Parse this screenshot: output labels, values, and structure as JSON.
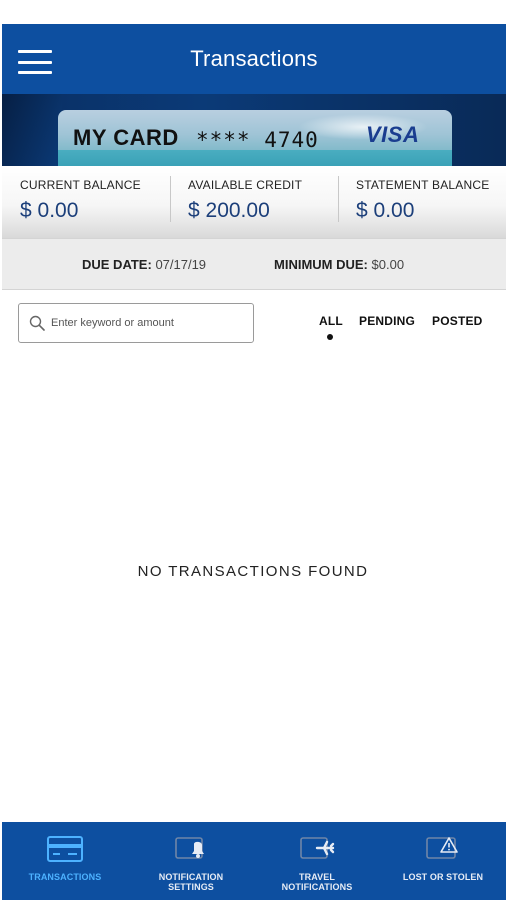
{
  "header": {
    "title": "Transactions",
    "menu_icon": "hamburger-menu-icon"
  },
  "card": {
    "name": "MY CARD",
    "number_masked": "**** 4740",
    "network": "VISA"
  },
  "balances": [
    {
      "label": "CURRENT BALANCE",
      "value": "$ 0.00"
    },
    {
      "label": "AVAILABLE CREDIT",
      "value": "$ 200.00"
    },
    {
      "label": "STATEMENT BALANCE",
      "value": "$ 0.00"
    }
  ],
  "due": {
    "due_date_label": "DUE DATE:",
    "due_date_value": "07/17/19",
    "minimum_due_label": "MINIMUM DUE:",
    "minimum_due_value": "$0.00"
  },
  "search": {
    "placeholder": "Enter keyword or amount",
    "icon": "search-icon"
  },
  "filters": {
    "all": "ALL",
    "pending": "PENDING",
    "posted": "POSTED",
    "selected": "ALL"
  },
  "empty_message": "NO TRANSACTIONS FOUND",
  "bottom_nav": [
    {
      "label": "TRANSACTIONS",
      "icon": "credit-card-icon",
      "active": true
    },
    {
      "label": "NOTIFICATION SETTINGS",
      "icon": "notification-bell-icon",
      "active": false
    },
    {
      "label": "TRAVEL NOTIFICATIONS",
      "icon": "airplane-card-icon",
      "active": false
    },
    {
      "label": "LOST OR STOLEN",
      "icon": "warning-card-icon",
      "active": false
    }
  ],
  "colors": {
    "brand_blue": "#0d4fa0",
    "balance_value": "#1c3f7a",
    "active_nav": "#4db2ff"
  }
}
